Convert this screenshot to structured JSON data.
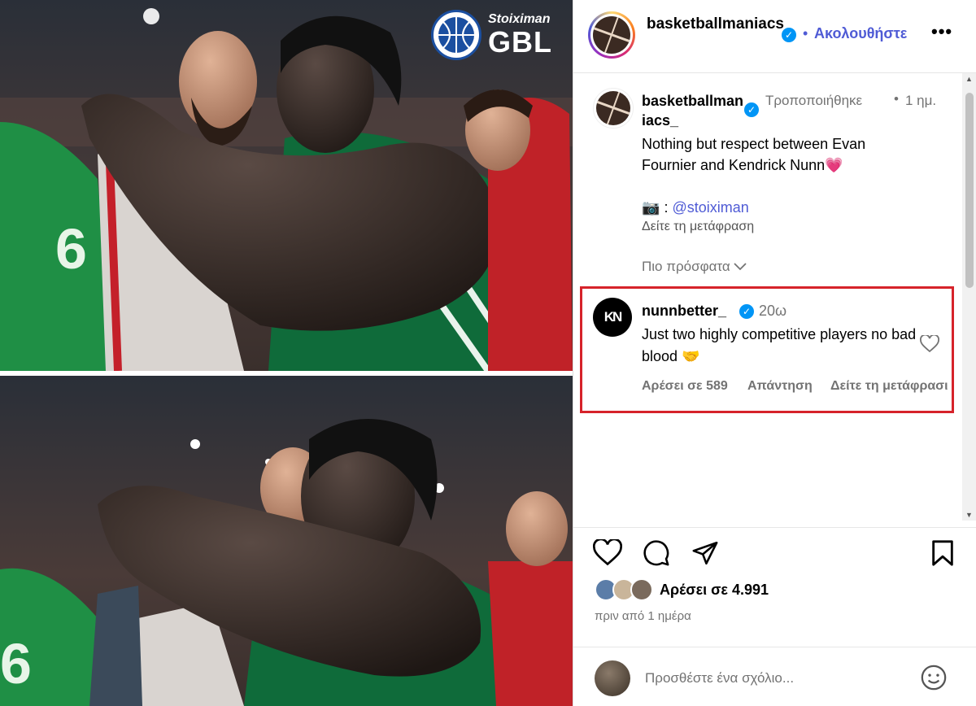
{
  "image": {
    "brand_small": "Stoiximan",
    "brand_large": "GBL"
  },
  "header": {
    "username": "basketballmaniacs_",
    "separator": "•",
    "follow_label": "Ακολουθήστε",
    "more_label": "•••"
  },
  "caption": {
    "username": "basketballmaniacs_",
    "edited": "Τροποποιήθηκε",
    "separator": "•",
    "time": "1 ημ.",
    "text": "Nothing but respect between Evan Fournier and Kendrick Nunn",
    "text_emoji": "💗",
    "credit_icon": "📷",
    "credit_sep": ":",
    "credit_link": "@stoiximan",
    "translate": "Δείτε τη μετάφραση"
  },
  "sort": {
    "label": "Πιο πρόσφατα",
    "chevron": "⌵"
  },
  "comment": {
    "avatar_text": "KN",
    "username": "nunnbetter_",
    "time": "20ω",
    "text": "Just two highly competitive players no bad blood",
    "text_emoji": "🤝",
    "likes": "Αρέσει σε 589",
    "reply": "Απάντηση",
    "translate": "Δείτε τη μετάφρασι"
  },
  "scrollbars": {
    "up": "▲",
    "down": "▼",
    "left": "◀",
    "right": "▶"
  },
  "actions": {
    "like_icon": "heart-outline-icon",
    "comment_icon": "comment-bubble-icon",
    "share_icon": "paper-plane-icon",
    "save_icon": "bookmark-icon",
    "likes_count": "Αρέσει σε 4.991",
    "post_time": "πριν από 1 ημέρα"
  },
  "add_comment": {
    "placeholder": "Προσθέστε ένα σχόλιο..."
  },
  "colors": {
    "accent": "#4f5bd5",
    "verified": "#0095f6",
    "highlight_border": "#d6232a",
    "muted_text": "#737373"
  }
}
